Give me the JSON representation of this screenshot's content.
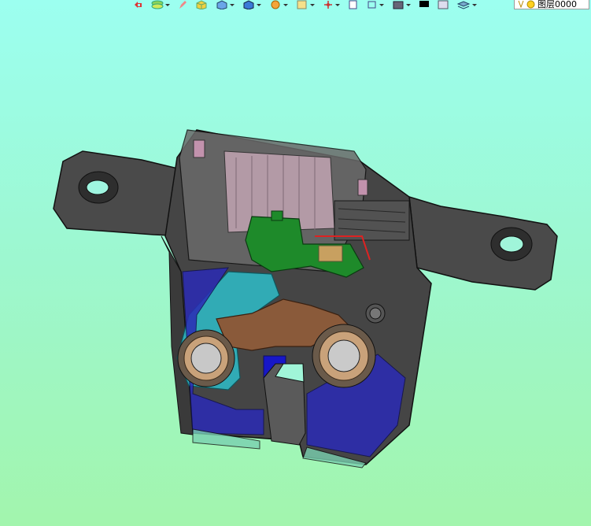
{
  "toolbar": {
    "layer_name": "图层0000",
    "icons": [
      "undo-icon",
      "layers-icon",
      "pencil-icon",
      "cube-yellow-icon",
      "cube-blue-icon",
      "cube-view-icon",
      "sphere-icon",
      "sheet-icon",
      "move-icon",
      "doc-icon",
      "frame-icon",
      "stack-icon",
      "black-color-icon",
      "white-color-icon",
      "layer-stack-icon",
      "bulb-icon"
    ]
  },
  "colors": {
    "background_top": "#9cfff0",
    "background_bottom": "#a2f5ad",
    "housing": "#3b3b3b",
    "motor": "#c7a9b8",
    "pcb": "#1e8a2a",
    "lever": "#8a5a3a",
    "cyan": "#2fb7c2",
    "blue": "#2a2ab5",
    "bushing": "#c9a27a"
  }
}
